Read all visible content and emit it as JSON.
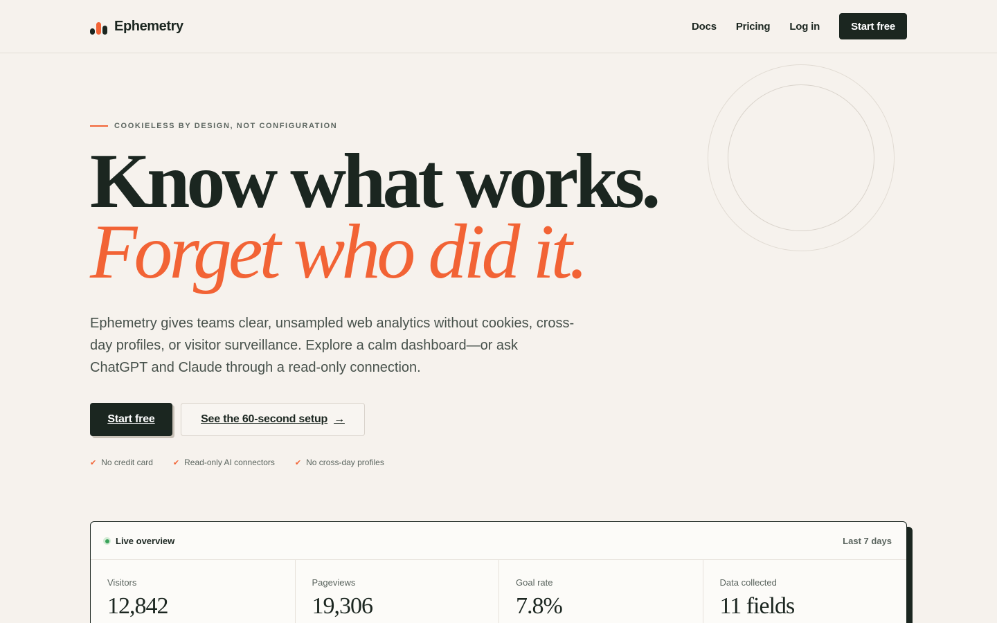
{
  "header": {
    "brand": "Ephemetry",
    "nav": [
      {
        "label": "Docs"
      },
      {
        "label": "Pricing"
      },
      {
        "label": "Log in"
      }
    ],
    "cta_label": "Start free"
  },
  "hero": {
    "eyebrow": "COOKIELESS BY DESIGN, NOT CONFIGURATION",
    "headline_line1": "Know what works.",
    "headline_line2": "Forget who did it.",
    "lede": "Ephemetry gives teams clear, unsampled web analytics without cookies, cross-day profiles, or visitor surveillance. Explore a calm dashboard—or ask ChatGPT and Claude through a read-only connection.",
    "primary_cta": "Start free",
    "secondary_cta": "See the 60-second setup",
    "checks": [
      "No credit card",
      "Read-only AI connectors",
      "No cross-day profiles"
    ]
  },
  "dashboard": {
    "title": "Live overview",
    "range": "Last 7 days",
    "stats": [
      {
        "label": "Visitors",
        "value": "12,842"
      },
      {
        "label": "Pageviews",
        "value": "19,306"
      },
      {
        "label": "Goal rate",
        "value": "7.8%"
      },
      {
        "label": "Data collected",
        "value": "11 fields"
      }
    ]
  },
  "colors": {
    "accent": "#f26335",
    "ink": "#1b2620",
    "background": "#f6f2ed",
    "live": "#3aa35a"
  }
}
